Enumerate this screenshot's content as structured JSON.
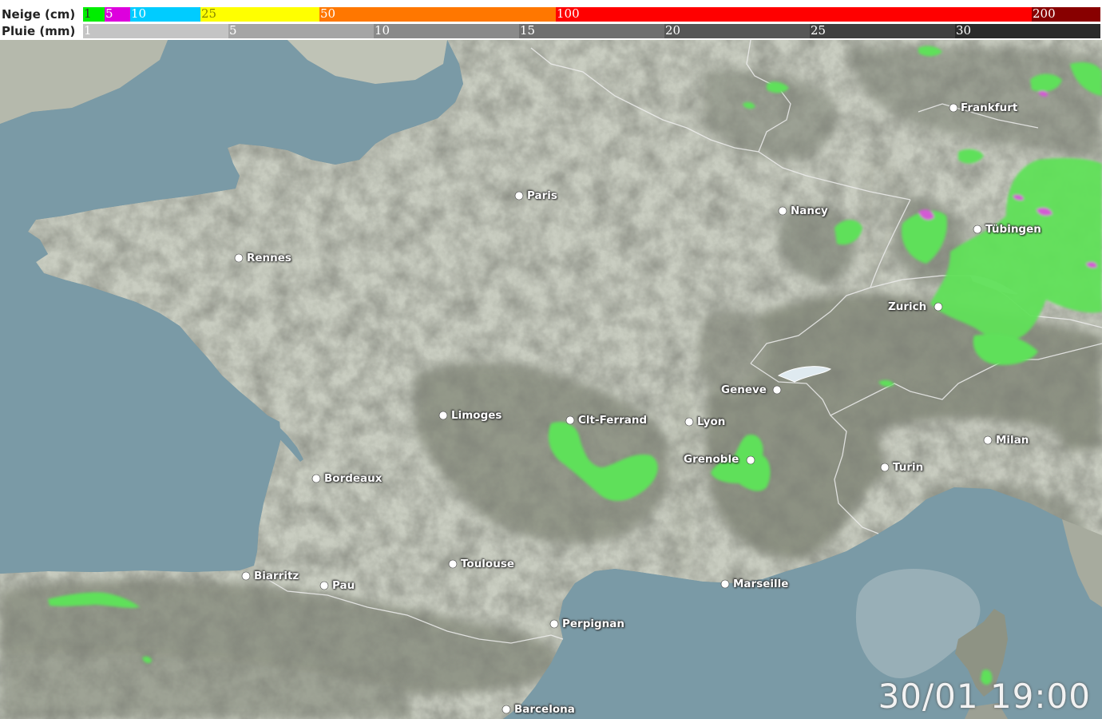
{
  "legend": {
    "snow": {
      "title": "Neige (cm)",
      "segments": [
        {
          "label": "1",
          "color": "#00ee00",
          "text_color": "#333333"
        },
        {
          "label": "5",
          "color": "#dd00dd",
          "text_color": "#ffffff"
        },
        {
          "label": "10",
          "color": "#00ccff",
          "text_color": "#ffffff"
        },
        {
          "label": "25",
          "color": "#ffff00",
          "text_color": "#888800"
        },
        {
          "label": "50",
          "color": "#ff7700",
          "text_color": "#ffffff"
        },
        {
          "label": "100",
          "color": "#ff0000",
          "text_color": "#ffffff"
        },
        {
          "label": "200",
          "color": "#880000",
          "text_color": "#ffffff"
        }
      ]
    },
    "rain": {
      "title": "Pluie (mm)",
      "segments": [
        {
          "label": "1",
          "color": "#c4c4c4",
          "text_color": "#ffffff"
        },
        {
          "label": "5",
          "color": "#a5a5a5",
          "text_color": "#ffffff"
        },
        {
          "label": "10",
          "color": "#8a8a8a",
          "text_color": "#ffffff"
        },
        {
          "label": "15",
          "color": "#6f6f6f",
          "text_color": "#ffffff"
        },
        {
          "label": "20",
          "color": "#565656",
          "text_color": "#ffffff"
        },
        {
          "label": "25",
          "color": "#404040",
          "text_color": "#ffffff"
        },
        {
          "label": "30",
          "color": "#2a2a2a",
          "text_color": "#ffffff"
        }
      ]
    }
  },
  "cities": [
    {
      "name": "Frankfurt"
    },
    {
      "name": "Paris"
    },
    {
      "name": "Nancy"
    },
    {
      "name": "Tübingen"
    },
    {
      "name": "Rennes"
    },
    {
      "name": "Zurich"
    },
    {
      "name": "Geneve"
    },
    {
      "name": "Limoges"
    },
    {
      "name": "Clt-Ferrand"
    },
    {
      "name": "Lyon"
    },
    {
      "name": "Milan"
    },
    {
      "name": "Grenoble"
    },
    {
      "name": "Turin"
    },
    {
      "name": "Bordeaux"
    },
    {
      "name": "Toulouse"
    },
    {
      "name": "Biarritz"
    },
    {
      "name": "Pau"
    },
    {
      "name": "Marseille"
    },
    {
      "name": "Perpignan"
    },
    {
      "name": "Barcelona"
    }
  ],
  "timestamp": "30/01 19:00",
  "colors": {
    "sea": "#7a9aa6",
    "land": "#c9cdc1",
    "mountains": "#8e9384",
    "snow": "#33dd33"
  }
}
